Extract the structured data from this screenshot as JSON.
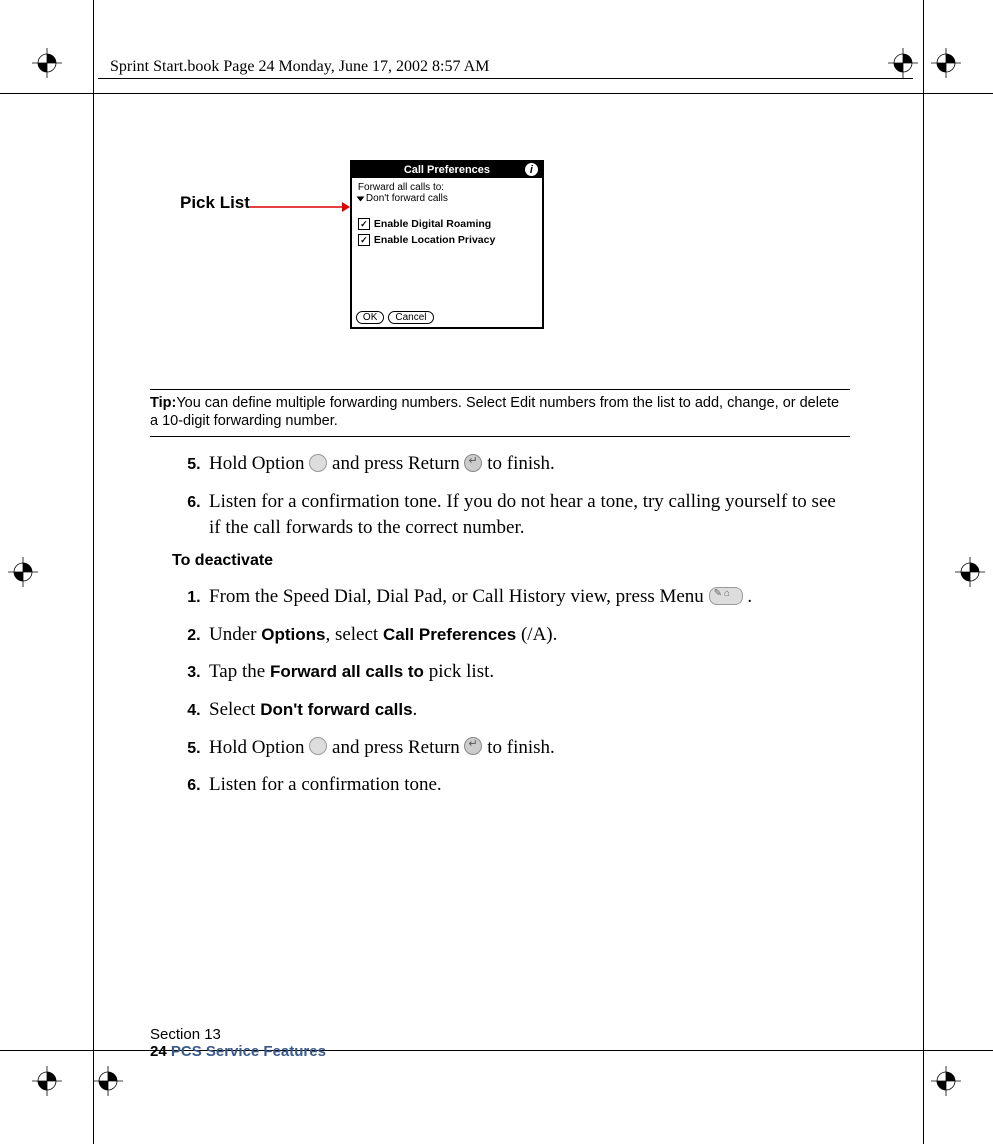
{
  "header": "Sprint Start.book  Page 24  Monday, June 17, 2002  8:57 AM",
  "figure": {
    "callout": "Pick List",
    "title": "Call Preferences",
    "info": "i",
    "forward_label": "Forward all calls to:",
    "picklist_value": "Don't forward calls",
    "check1": "Enable Digital Roaming",
    "check2": "Enable Location Privacy",
    "btn_ok": "OK",
    "btn_cancel": "Cancel"
  },
  "tip": {
    "label": "Tip:",
    "text": "You can define multiple forwarding numbers. Select Edit numbers from the list to add, change, or delete a 10-digit forwarding number."
  },
  "steps_a": {
    "s5a": "Hold Option ",
    "s5b": " and press Return ",
    "s5c": " to finish.",
    "s6": "Listen for a confirmation tone. If you do not hear a tone, try calling yourself to see if the call forwards to the correct number."
  },
  "subhead": "To deactivate",
  "steps_b": {
    "s1a": "From the Speed Dial, Dial Pad, or Call History view, press Menu ",
    "s1b": " .",
    "s2a": "Under ",
    "s2b": "Options",
    "s2c": ", select ",
    "s2d": "Call Preferences",
    "s2e": " (/A).",
    "s3a": "Tap the ",
    "s3b": "Forward all calls to",
    "s3c": " pick list.",
    "s4a": "Select ",
    "s4b": "Don't forward calls",
    "s4c": ".",
    "s5a": "Hold Option ",
    "s5b": " and press Return ",
    "s5c": " to finish.",
    "s6": "Listen for a confirmation tone."
  },
  "footer": {
    "section": "Section 13",
    "page": "24",
    "title": "PCS Service Features"
  }
}
